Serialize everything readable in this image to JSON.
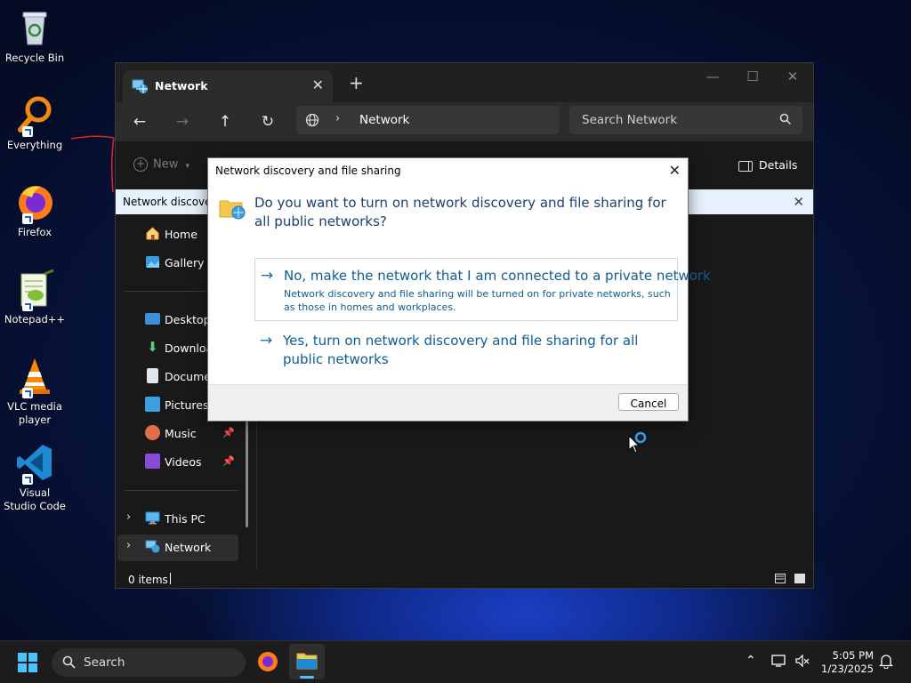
{
  "desktop": {
    "icons": [
      {
        "label": "Recycle Bin"
      },
      {
        "label": "Everything"
      },
      {
        "label": "Firefox"
      },
      {
        "label": "Notepad++"
      },
      {
        "label": "VLC media player"
      },
      {
        "label": "Visual Studio Code"
      }
    ]
  },
  "explorer": {
    "tab_title": "Network",
    "new_tab_glyph": "+",
    "address": {
      "location": "Network"
    },
    "search": {
      "placeholder": "Search Network"
    },
    "toolbar": {
      "new_label": "New",
      "details_label": "Details"
    },
    "infobar": {
      "text": "Network discovery"
    },
    "sidebar": {
      "items": [
        {
          "label": "Home"
        },
        {
          "label": "Gallery"
        },
        {
          "label": "Desktop"
        },
        {
          "label": "Downloads"
        },
        {
          "label": "Documents"
        },
        {
          "label": "Pictures"
        },
        {
          "label": "Music"
        },
        {
          "label": "Videos"
        },
        {
          "label": "This PC"
        },
        {
          "label": "Network"
        }
      ]
    },
    "status": {
      "items_text": "0 items"
    }
  },
  "dialog": {
    "title": "Network discovery and file sharing",
    "question": "Do you want to turn on network discovery and file sharing for all public networks?",
    "option_private": {
      "title": "No, make the network that I am connected to a private network",
      "description": "Network discovery and file sharing will be turned on for private networks, such as those in homes and workplaces."
    },
    "option_public": {
      "title": "Yes, turn on network discovery and file sharing for all public networks"
    },
    "cancel_label": "Cancel"
  },
  "taskbar": {
    "search_label": "Search",
    "time": "5:05 PM",
    "date": "1/23/2025"
  },
  "colors": {
    "accent": "#0d5c97",
    "infobar_bg": "#e6f1fb",
    "window_bg": "#191919"
  }
}
